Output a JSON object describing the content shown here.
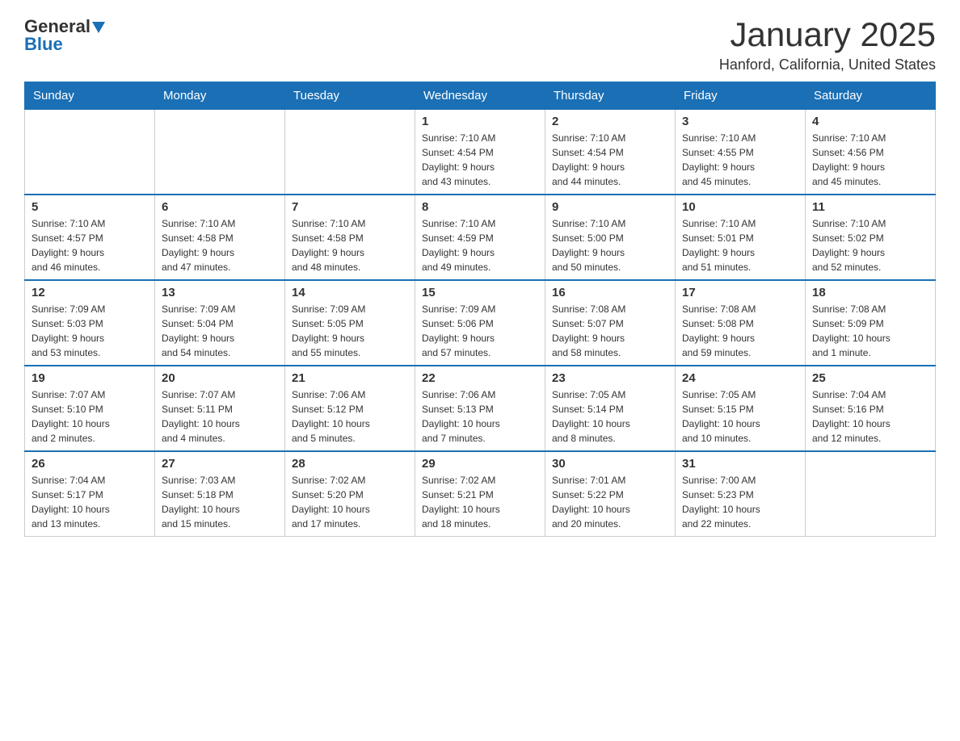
{
  "logo": {
    "text_general": "General",
    "text_blue": "Blue",
    "arrow": "▼"
  },
  "header": {
    "month": "January 2025",
    "location": "Hanford, California, United States"
  },
  "days_of_week": [
    "Sunday",
    "Monday",
    "Tuesday",
    "Wednesday",
    "Thursday",
    "Friday",
    "Saturday"
  ],
  "weeks": [
    [
      {
        "day": "",
        "info": ""
      },
      {
        "day": "",
        "info": ""
      },
      {
        "day": "",
        "info": ""
      },
      {
        "day": "1",
        "info": "Sunrise: 7:10 AM\nSunset: 4:54 PM\nDaylight: 9 hours\nand 43 minutes."
      },
      {
        "day": "2",
        "info": "Sunrise: 7:10 AM\nSunset: 4:54 PM\nDaylight: 9 hours\nand 44 minutes."
      },
      {
        "day": "3",
        "info": "Sunrise: 7:10 AM\nSunset: 4:55 PM\nDaylight: 9 hours\nand 45 minutes."
      },
      {
        "day": "4",
        "info": "Sunrise: 7:10 AM\nSunset: 4:56 PM\nDaylight: 9 hours\nand 45 minutes."
      }
    ],
    [
      {
        "day": "5",
        "info": "Sunrise: 7:10 AM\nSunset: 4:57 PM\nDaylight: 9 hours\nand 46 minutes."
      },
      {
        "day": "6",
        "info": "Sunrise: 7:10 AM\nSunset: 4:58 PM\nDaylight: 9 hours\nand 47 minutes."
      },
      {
        "day": "7",
        "info": "Sunrise: 7:10 AM\nSunset: 4:58 PM\nDaylight: 9 hours\nand 48 minutes."
      },
      {
        "day": "8",
        "info": "Sunrise: 7:10 AM\nSunset: 4:59 PM\nDaylight: 9 hours\nand 49 minutes."
      },
      {
        "day": "9",
        "info": "Sunrise: 7:10 AM\nSunset: 5:00 PM\nDaylight: 9 hours\nand 50 minutes."
      },
      {
        "day": "10",
        "info": "Sunrise: 7:10 AM\nSunset: 5:01 PM\nDaylight: 9 hours\nand 51 minutes."
      },
      {
        "day": "11",
        "info": "Sunrise: 7:10 AM\nSunset: 5:02 PM\nDaylight: 9 hours\nand 52 minutes."
      }
    ],
    [
      {
        "day": "12",
        "info": "Sunrise: 7:09 AM\nSunset: 5:03 PM\nDaylight: 9 hours\nand 53 minutes."
      },
      {
        "day": "13",
        "info": "Sunrise: 7:09 AM\nSunset: 5:04 PM\nDaylight: 9 hours\nand 54 minutes."
      },
      {
        "day": "14",
        "info": "Sunrise: 7:09 AM\nSunset: 5:05 PM\nDaylight: 9 hours\nand 55 minutes."
      },
      {
        "day": "15",
        "info": "Sunrise: 7:09 AM\nSunset: 5:06 PM\nDaylight: 9 hours\nand 57 minutes."
      },
      {
        "day": "16",
        "info": "Sunrise: 7:08 AM\nSunset: 5:07 PM\nDaylight: 9 hours\nand 58 minutes."
      },
      {
        "day": "17",
        "info": "Sunrise: 7:08 AM\nSunset: 5:08 PM\nDaylight: 9 hours\nand 59 minutes."
      },
      {
        "day": "18",
        "info": "Sunrise: 7:08 AM\nSunset: 5:09 PM\nDaylight: 10 hours\nand 1 minute."
      }
    ],
    [
      {
        "day": "19",
        "info": "Sunrise: 7:07 AM\nSunset: 5:10 PM\nDaylight: 10 hours\nand 2 minutes."
      },
      {
        "day": "20",
        "info": "Sunrise: 7:07 AM\nSunset: 5:11 PM\nDaylight: 10 hours\nand 4 minutes."
      },
      {
        "day": "21",
        "info": "Sunrise: 7:06 AM\nSunset: 5:12 PM\nDaylight: 10 hours\nand 5 minutes."
      },
      {
        "day": "22",
        "info": "Sunrise: 7:06 AM\nSunset: 5:13 PM\nDaylight: 10 hours\nand 7 minutes."
      },
      {
        "day": "23",
        "info": "Sunrise: 7:05 AM\nSunset: 5:14 PM\nDaylight: 10 hours\nand 8 minutes."
      },
      {
        "day": "24",
        "info": "Sunrise: 7:05 AM\nSunset: 5:15 PM\nDaylight: 10 hours\nand 10 minutes."
      },
      {
        "day": "25",
        "info": "Sunrise: 7:04 AM\nSunset: 5:16 PM\nDaylight: 10 hours\nand 12 minutes."
      }
    ],
    [
      {
        "day": "26",
        "info": "Sunrise: 7:04 AM\nSunset: 5:17 PM\nDaylight: 10 hours\nand 13 minutes."
      },
      {
        "day": "27",
        "info": "Sunrise: 7:03 AM\nSunset: 5:18 PM\nDaylight: 10 hours\nand 15 minutes."
      },
      {
        "day": "28",
        "info": "Sunrise: 7:02 AM\nSunset: 5:20 PM\nDaylight: 10 hours\nand 17 minutes."
      },
      {
        "day": "29",
        "info": "Sunrise: 7:02 AM\nSunset: 5:21 PM\nDaylight: 10 hours\nand 18 minutes."
      },
      {
        "day": "30",
        "info": "Sunrise: 7:01 AM\nSunset: 5:22 PM\nDaylight: 10 hours\nand 20 minutes."
      },
      {
        "day": "31",
        "info": "Sunrise: 7:00 AM\nSunset: 5:23 PM\nDaylight: 10 hours\nand 22 minutes."
      },
      {
        "day": "",
        "info": ""
      }
    ]
  ]
}
